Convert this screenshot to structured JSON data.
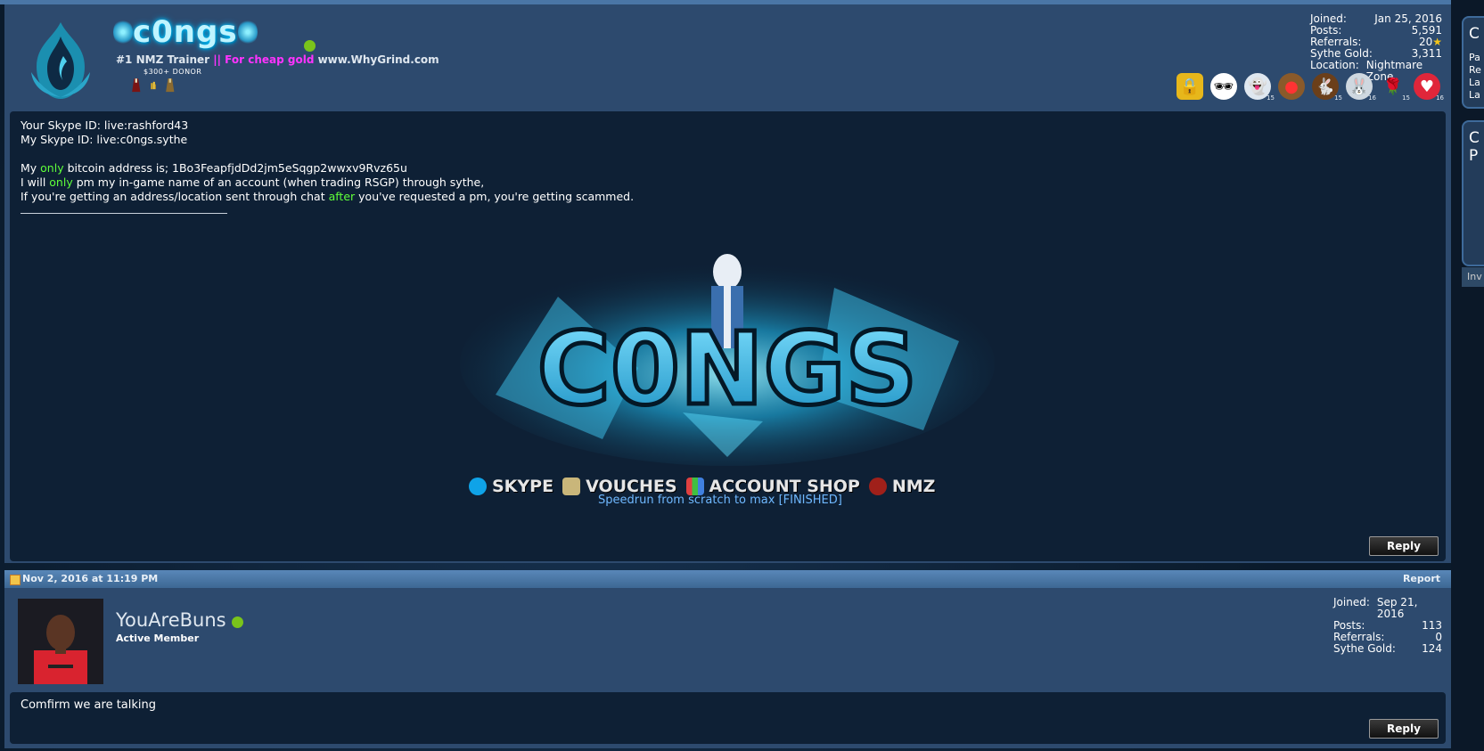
{
  "post1": {
    "username": "c0ngs",
    "user_title_prefix": "#1 NMZ Trainer ",
    "user_title_sep": "|| For cheap gold ",
    "user_title_site": "www.WhyGrind.com",
    "donor_label": "$300+ DONOR",
    "stats": [
      {
        "label": "Joined:",
        "value": "Jan 25, 2016"
      },
      {
        "label": "Posts:",
        "value": "5,591"
      },
      {
        "label": "Referrals:",
        "value": "20"
      },
      {
        "label": "Sythe Gold:",
        "value": "3,311"
      },
      {
        "label": "Location:",
        "value": "Nightmare Zone"
      }
    ],
    "badges": [
      {
        "icon": "padlock-icon",
        "count": ""
      },
      {
        "icon": "heisenberg-icon",
        "count": ""
      },
      {
        "icon": "ghost-icon",
        "count": "15"
      },
      {
        "icon": "reindeer-icon",
        "count": ""
      },
      {
        "icon": "bunny-icon",
        "count": "15"
      },
      {
        "icon": "easter-bunny-icon",
        "count": "16"
      },
      {
        "icon": "rose-icon",
        "count": "15"
      },
      {
        "icon": "heart-icon",
        "count": "16"
      }
    ],
    "message": {
      "line1": "Your Skype ID: live:rashford43",
      "line2": "My Skype ID: live:c0ngs.sythe",
      "line3a": "My ",
      "line3b": "only",
      "line3c": " bitcoin address is; 1Bo3FeapfjdDd2jm5eSqgp2wwxv9Rvz65u",
      "line4a": "I will ",
      "line4b": "only",
      "line4c": " pm my in-game name of an account (when trading RSGP) through sythe,",
      "line5a": "If you're getting an address/location sent through chat ",
      "line5b": "after",
      "line5c": " you've requested a pm, you're getting scammed."
    },
    "banner_text": "C0NGS",
    "links": [
      "SKYPE",
      "VOUCHES",
      "ACCOUNT SHOP",
      "NMZ"
    ],
    "speedrun": "Speedrun from scratch to max [FINISHED]",
    "reply": "Reply"
  },
  "datebar": {
    "date": "Nov 2, 2016 at 11:19 PM",
    "report": "Report"
  },
  "post2": {
    "username": "YouAreBuns",
    "user_title": "Active Member",
    "stats": [
      {
        "label": "Joined:",
        "value": "Sep 21, 2016"
      },
      {
        "label": "Posts:",
        "value": "113"
      },
      {
        "label": "Referrals:",
        "value": "0"
      },
      {
        "label": "Sythe Gold:",
        "value": "124"
      }
    ],
    "message": "Comfirm we are talking",
    "reply": "Reply"
  },
  "sidebar": {
    "card1": "C",
    "card1_lines": [
      "Pa",
      "Re",
      "La",
      "La"
    ],
    "card2": "C",
    "card2_sub": "P",
    "button": "Inv"
  }
}
